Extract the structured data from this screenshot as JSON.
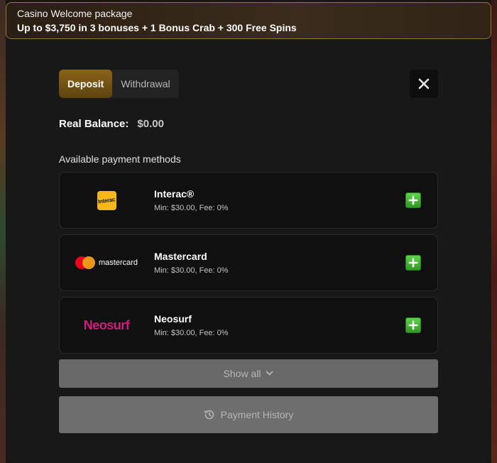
{
  "promo": {
    "title": "Casino Welcome package",
    "offer": "Up to $3,750 in 3 bonuses + 1 Bonus Crab + 300 Free Spins"
  },
  "tabs": [
    {
      "label": "Deposit",
      "active": true
    },
    {
      "label": "Withdrawal",
      "active": false
    }
  ],
  "balance": {
    "label": "Real Balance:",
    "value": "$0.00"
  },
  "methods_heading": "Available payment methods",
  "methods": [
    {
      "name": "Interac®",
      "terms": "Min: $30.00, Fee: 0%",
      "logo_text": "Interac",
      "icon": "plus-icon"
    },
    {
      "name": "Mastercard",
      "terms": "Min: $30.00, Fee: 0%",
      "logo_text": "mastercard",
      "icon": "plus-icon"
    },
    {
      "name": "Neosurf",
      "terms": "Min: $30.00, Fee: 0%",
      "logo_text": "Neosurf",
      "icon": "plus-icon"
    }
  ],
  "show_all_label": "Show all",
  "history_label": "Payment History",
  "colors": {
    "accent_gold": "#8a6418",
    "add_green": "#3fb52e",
    "neosurf_pink": "#d21b7e",
    "interac_yellow": "#f6b818"
  }
}
